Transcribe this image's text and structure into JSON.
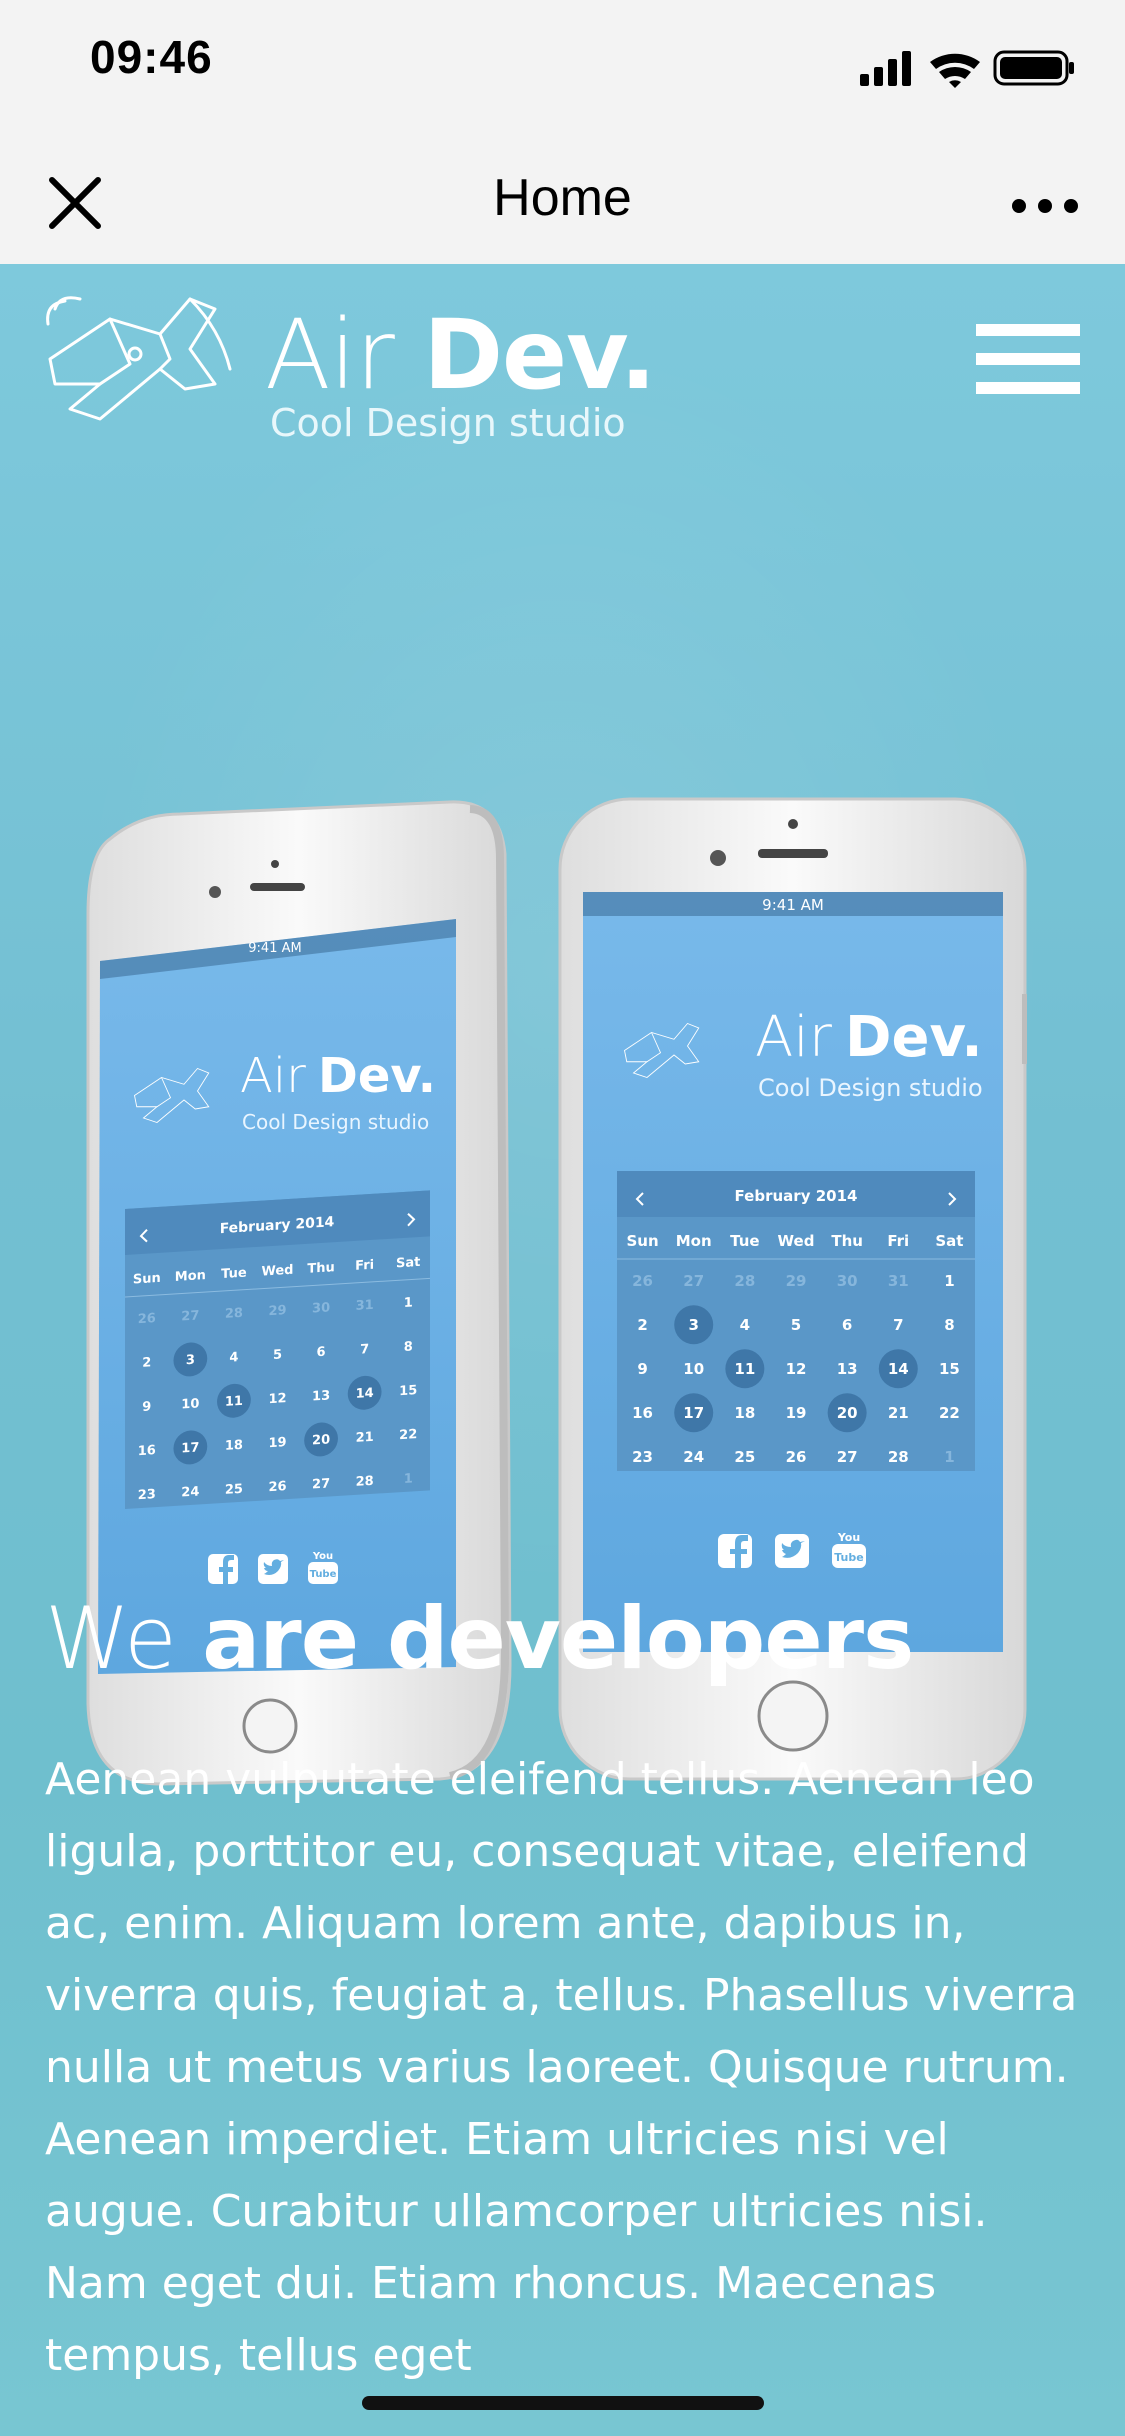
{
  "status_bar": {
    "time": "09:46"
  },
  "nav": {
    "title": "Home",
    "close_icon": "close-icon",
    "more_icon": "more-icon"
  },
  "brand": {
    "name_light": "Air",
    "name_bold": "Dev.",
    "tagline": "Cool Design studio",
    "logo_icon": "airplane-logo-icon"
  },
  "menu": {
    "icon": "hamburger-menu-icon"
  },
  "mockup": {
    "status_time": "9:41 AM",
    "month": "February 2014",
    "weekdays": [
      "Sun",
      "Mon",
      "Tue",
      "Wed",
      "Thu",
      "Fri",
      "Sat"
    ],
    "weeks": [
      [
        "26",
        "27",
        "28",
        "29",
        "30",
        "31",
        "1"
      ],
      [
        "2",
        "3",
        "4",
        "5",
        "6",
        "7",
        "8"
      ],
      [
        "9",
        "10",
        "11",
        "12",
        "13",
        "14",
        "15"
      ],
      [
        "16",
        "17",
        "18",
        "19",
        "20",
        "21",
        "22"
      ],
      [
        "23",
        "24",
        "25",
        "26",
        "27",
        "28",
        "1"
      ]
    ],
    "highlighted_days": [
      "3",
      "11",
      "14",
      "17",
      "20"
    ],
    "youtube_label_top": "You",
    "youtube_label_bottom": "Tube",
    "social_icons": [
      "facebook-icon",
      "twitter-icon",
      "youtube-icon"
    ]
  },
  "headline": {
    "light": "We",
    "bold": "are developers"
  },
  "body": "Aenean vulputate eleifend tellus. Aenean leo ligula, porttitor eu, consequat vitae, eleifend ac, enim. Aliquam lorem ante, dapibus in, viverra quis, feugiat a, tellus. Phasellus viverra nulla ut metus varius laoreet. Quisque rutrum. Aenean imperdiet. Etiam ultricies nisi vel augue. Curabitur ullamcorper ultricies nisi. Nam eget dui. Etiam rhoncus. Maecenas tempus, tellus eget",
  "colors": {
    "hero_bg": "#74c2d4",
    "screen_blue": "#66ade2",
    "calendar_panel": "#5a97c8",
    "highlight_circle": "#3f77a8"
  }
}
